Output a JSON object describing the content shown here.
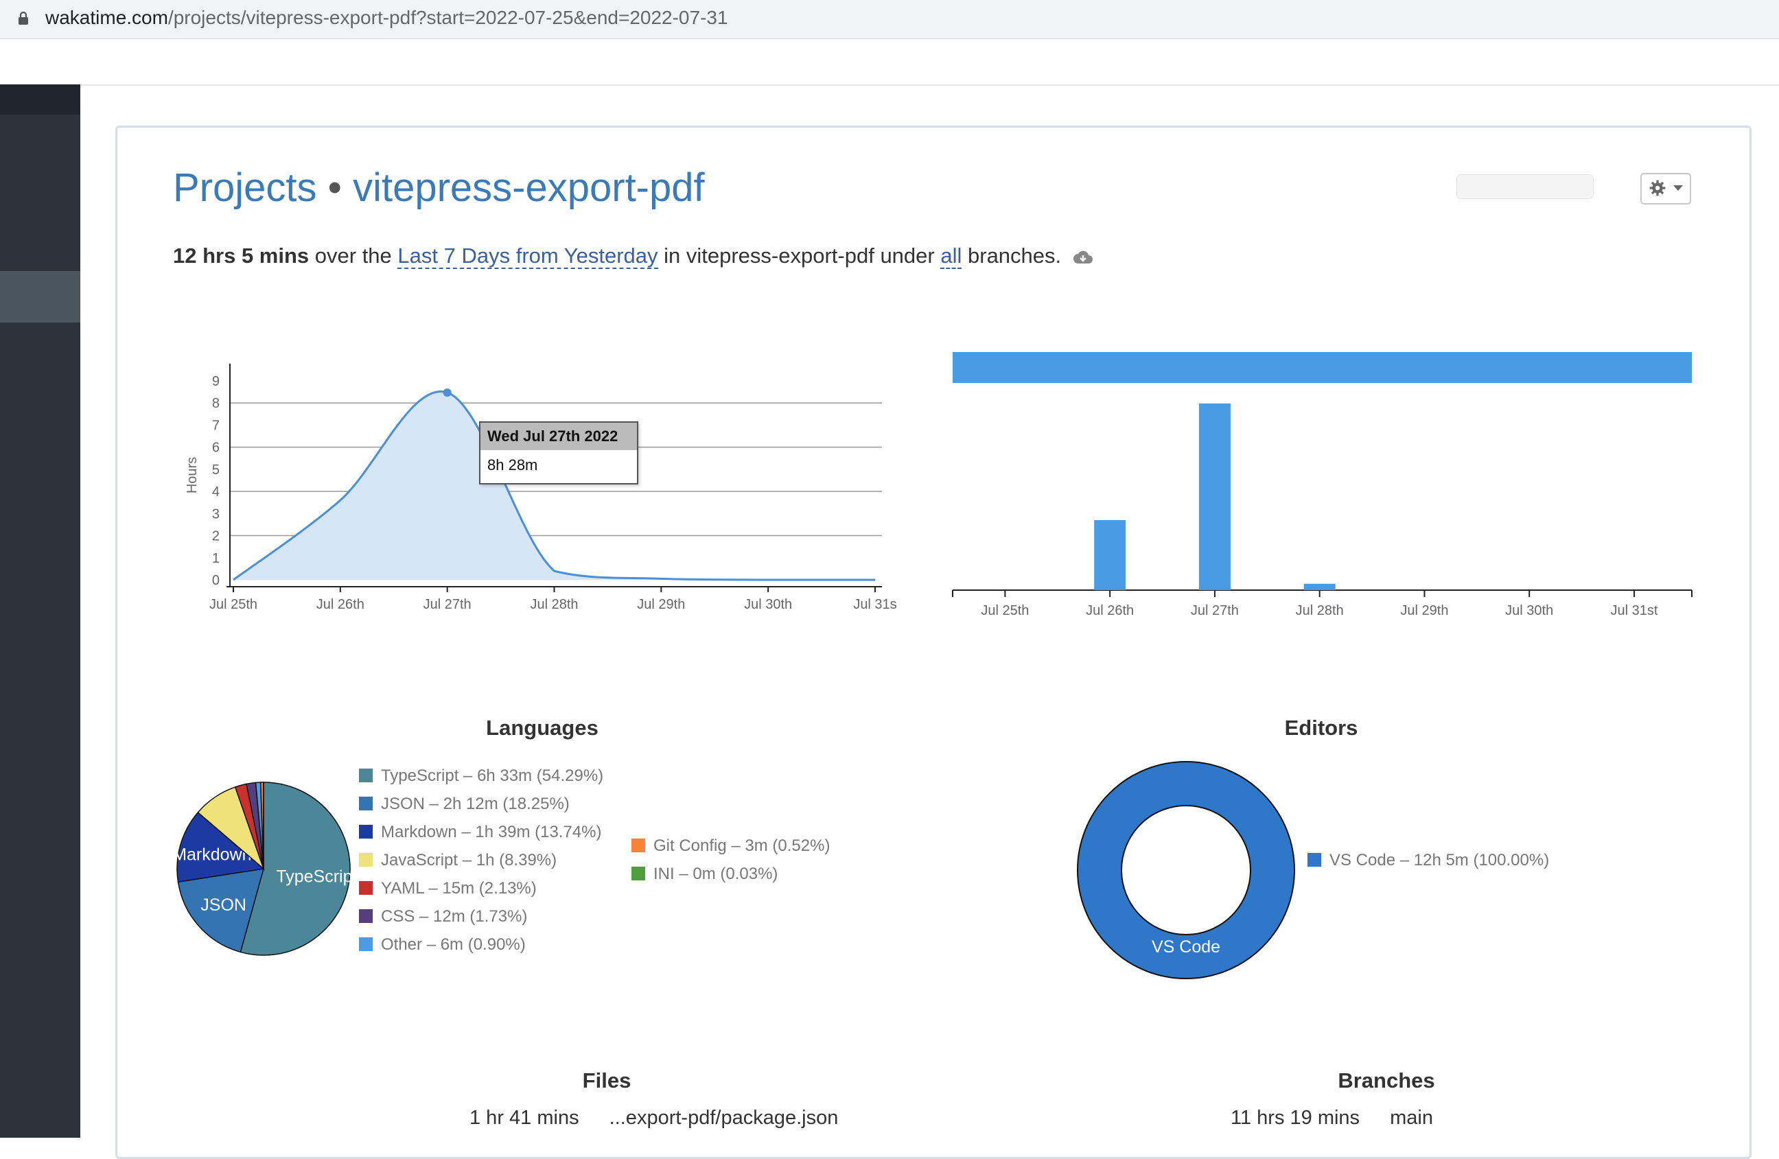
{
  "browser": {
    "url_host": "wakatime.com",
    "url_path": "/projects/vitepress-export-pdf?start=2022-07-25&end=2022-07-31"
  },
  "header": {
    "title_section": "Projects",
    "title_separator": "•",
    "title_project": "vitepress-export-pdf"
  },
  "summary": {
    "total": "12 hrs 5 mins",
    "over_the": "over the",
    "range_link": "Last 7 Days from Yesterday",
    "in_text": "in vitepress-export-pdf under",
    "branches_link": "all",
    "branches_text": "branches."
  },
  "icons": {
    "lock": "lock-icon",
    "gear": "gear-icon",
    "caret": "caret-down-icon",
    "cloud": "cloud-download-icon"
  },
  "colors": {
    "accent": "#3a7ab8",
    "line": "#4a90d9",
    "bar": "#4a9be6",
    "vscode": "#2f77c8"
  },
  "chart_data": [
    {
      "type": "area",
      "ylabel": "Hours",
      "x": [
        "Jul 25th",
        "Jul 26th",
        "Jul 27th",
        "Jul 28th",
        "Jul 29th",
        "Jul 30th",
        "Jul 31s"
      ],
      "values": [
        0,
        3.6,
        8.47,
        0.4,
        0.05,
        0,
        0
      ],
      "ylim": [
        0,
        9
      ],
      "yticks": [
        "0",
        "1",
        "2",
        "3",
        "4",
        "5",
        "6",
        "7",
        "8",
        "9"
      ],
      "grid": true,
      "tooltip": {
        "title": "Wed Jul 27th 2022",
        "value": "8h 28m"
      }
    },
    {
      "type": "bar",
      "categories": [
        "Jul 25th",
        "Jul 26th",
        "Jul 27th",
        "Jul 28th",
        "Jul 29th",
        "Jul 30th",
        "Jul 31st"
      ],
      "values": [
        0,
        3.3,
        8.8,
        0.3,
        0,
        0,
        0
      ],
      "grid": false
    },
    {
      "type": "pie",
      "title": "Languages",
      "series": [
        {
          "name": "TypeScript",
          "label": "TypeScript – 6h 33m (54.29%)",
          "value": 54.29,
          "color": "#4b8699",
          "slice_label": "TypeScript"
        },
        {
          "name": "JSON",
          "label": "JSON – 2h 12m (18.25%)",
          "value": 18.25,
          "color": "#3474b2",
          "slice_label": "JSON"
        },
        {
          "name": "Markdown",
          "label": "Markdown – 1h 39m (13.74%)",
          "value": 13.74,
          "color": "#1c3aa1",
          "slice_label": "Markdown"
        },
        {
          "name": "JavaScript",
          "label": "JavaScript – 1h (8.39%)",
          "value": 8.39,
          "color": "#efe27b",
          "slice_label": ""
        },
        {
          "name": "YAML",
          "label": "YAML – 15m (2.13%)",
          "value": 2.13,
          "color": "#c9322c",
          "slice_label": ""
        },
        {
          "name": "CSS",
          "label": "CSS – 12m (1.73%)",
          "value": 1.73,
          "color": "#563d7c",
          "slice_label": ""
        },
        {
          "name": "Other",
          "label": "Other – 6m (0.90%)",
          "value": 0.9,
          "color": "#4b9be6",
          "slice_label": ""
        },
        {
          "name": "Git Config",
          "label": "Git Config – 3m (0.52%)",
          "value": 0.52,
          "color": "#f5843a",
          "slice_label": ""
        },
        {
          "name": "INI",
          "label": "INI – 0m (0.03%)",
          "value": 0.03,
          "color": "#4f9e3b",
          "slice_label": ""
        }
      ]
    },
    {
      "type": "pie",
      "title": "Editors",
      "series": [
        {
          "name": "VS Code",
          "label": "VS Code – 12h 5m (100.00%)",
          "value": 100,
          "color": "#2f77c8",
          "slice_label": "VS Code"
        }
      ]
    }
  ],
  "files": {
    "title": "Files",
    "rows": [
      {
        "time": "1 hr 41 mins",
        "name": "...export-pdf/package.json"
      }
    ]
  },
  "branches": {
    "title": "Branches",
    "rows": [
      {
        "time": "11 hrs 19 mins",
        "name": "main"
      }
    ]
  }
}
